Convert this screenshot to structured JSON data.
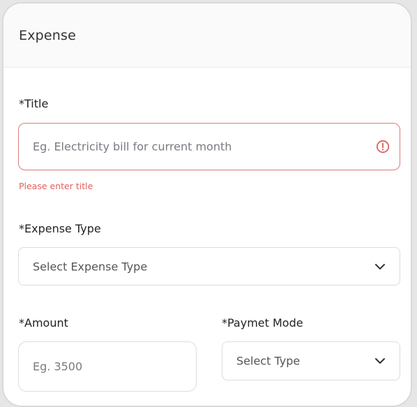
{
  "header": {
    "title": "Expense"
  },
  "title_field": {
    "label": "*Title",
    "placeholder": "Eg. Electricity bill for current month",
    "error_message": "Please enter title"
  },
  "expense_type": {
    "label": "*Expense Type",
    "selected": "Select Expense Type"
  },
  "amount": {
    "label": "*Amount",
    "placeholder": "Eg. 3500"
  },
  "payment_mode": {
    "label": "*Paymet Mode",
    "selected": "Select Type"
  },
  "icons": {
    "error": "alert-circle-icon",
    "dropdown": "chevron-down-icon"
  },
  "colors": {
    "error": "#e0625f",
    "error_border": "#e07a7a",
    "border": "#dcdcdc",
    "text": "#222222"
  }
}
